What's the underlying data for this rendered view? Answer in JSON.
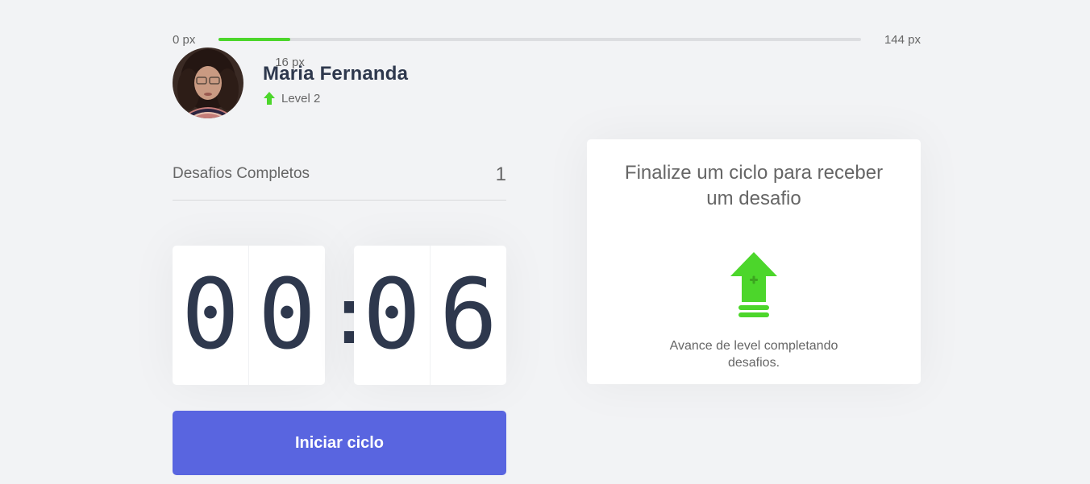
{
  "experience": {
    "min_label": "0 px",
    "max_label": "144 px",
    "current_label": "16 px",
    "current": 16,
    "max": 144,
    "fill_color": "#4cd62b"
  },
  "profile": {
    "name": "Maria Fernanda",
    "level_label": "Level 2",
    "level_icon": "level-up-arrow-icon"
  },
  "completed_challenges": {
    "label": "Desafios Completos",
    "count": "1"
  },
  "countdown": {
    "minute_left": "0",
    "minute_right": "0",
    "separator": ":",
    "second_left": "0",
    "second_right": "6"
  },
  "start_button": {
    "label": "Iniciar ciclo",
    "color": "#5965e0"
  },
  "challenge_card": {
    "title": "Finalize um ciclo para receber um desafio",
    "icon": "level-up-icon",
    "text": "Avance de level completando desafios."
  }
}
